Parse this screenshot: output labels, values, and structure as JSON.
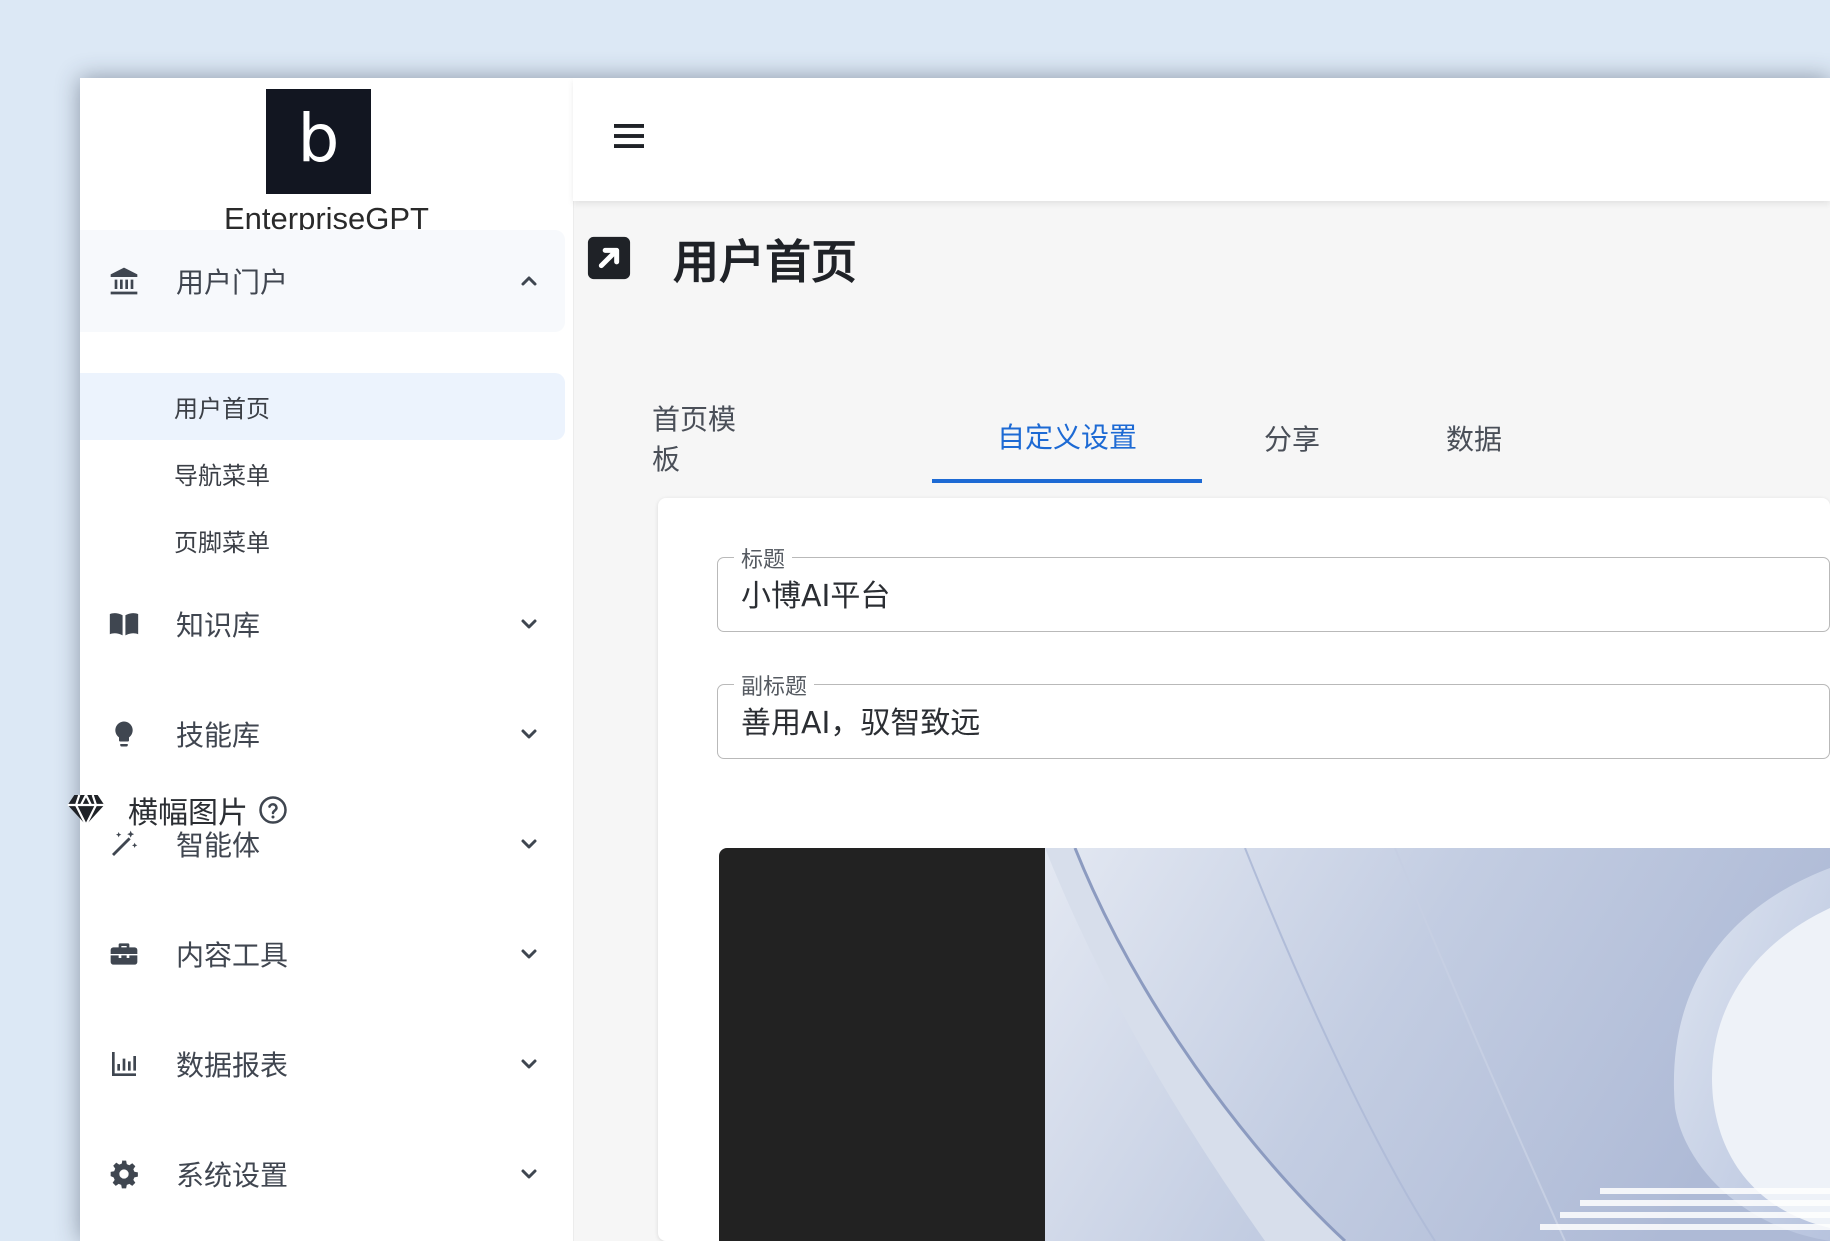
{
  "brand": {
    "logo_letter": "b",
    "name": "EnterpriseGPT"
  },
  "sidebar": {
    "groups": [
      {
        "label": "用户门户",
        "icon": "bank-icon",
        "expanded": true
      },
      {
        "label": "知识库",
        "icon": "book-icon",
        "expanded": false
      },
      {
        "label": "技能库",
        "icon": "lightbulb-icon",
        "expanded": false
      },
      {
        "label": "智能体",
        "icon": "magic-wand-icon",
        "expanded": false
      },
      {
        "label": "内容工具",
        "icon": "toolbox-icon",
        "expanded": false
      },
      {
        "label": "数据报表",
        "icon": "bar-chart-icon",
        "expanded": false
      },
      {
        "label": "系统设置",
        "icon": "gear-icon",
        "expanded": false
      }
    ],
    "sub_items": [
      {
        "label": "用户首页",
        "active": true
      },
      {
        "label": "导航菜单",
        "active": false
      },
      {
        "label": "页脚菜单",
        "active": false
      }
    ]
  },
  "page": {
    "title": "用户首页",
    "icon": "external-link-icon"
  },
  "tabs": [
    {
      "label": "首页模板",
      "active": false
    },
    {
      "label": "自定义设置",
      "active": true
    },
    {
      "label": "分享",
      "active": false
    },
    {
      "label": "数据",
      "active": false
    }
  ],
  "form": {
    "title_label": "标题",
    "title_value": "小博AI平台",
    "subtitle_label": "副标题",
    "subtitle_value": "善用AI，驭智致远",
    "banner_label": "横幅图片",
    "banner_icon": "gem-icon",
    "help_icon": "help-circle-icon"
  },
  "colors": {
    "accent": "#1d6ad4",
    "sidebar_active_bg": "#ecf3fd",
    "logo_bg": "#121621",
    "page_bg": "#dce8f5"
  }
}
